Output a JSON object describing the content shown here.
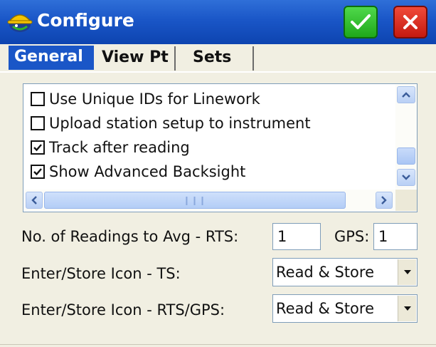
{
  "window": {
    "title": "Configure",
    "icons": {
      "app": "hardhat-surveyor-icon",
      "ok": "checkmark-icon",
      "close": "close-x-icon"
    },
    "colors": {
      "titlebar": "#1a56c7",
      "ok": "#1fa81a",
      "close": "#d01e12",
      "panel": "#f1efe2"
    }
  },
  "tabs": [
    {
      "label": "General",
      "active": true
    },
    {
      "label": "View Pt",
      "active": false
    },
    {
      "label": "Sets",
      "active": false
    }
  ],
  "options": [
    {
      "label": "Use Unique IDs for Linework",
      "checked": false
    },
    {
      "label": "Upload station setup to instrument",
      "checked": false
    },
    {
      "label": "Track after reading",
      "checked": true
    },
    {
      "label": "Show Advanced Backsight",
      "checked": true
    }
  ],
  "readings": {
    "label": "No. of Readings to Avg  -  RTS:",
    "rts_value": "1",
    "gps_label": "GPS:",
    "gps_value": "1"
  },
  "enter_store_ts": {
    "label": "Enter/Store Icon - TS:",
    "value": "Read & Store"
  },
  "enter_store_rtsgps": {
    "label": "Enter/Store Icon - RTS/GPS:",
    "value": "Read & Store"
  }
}
